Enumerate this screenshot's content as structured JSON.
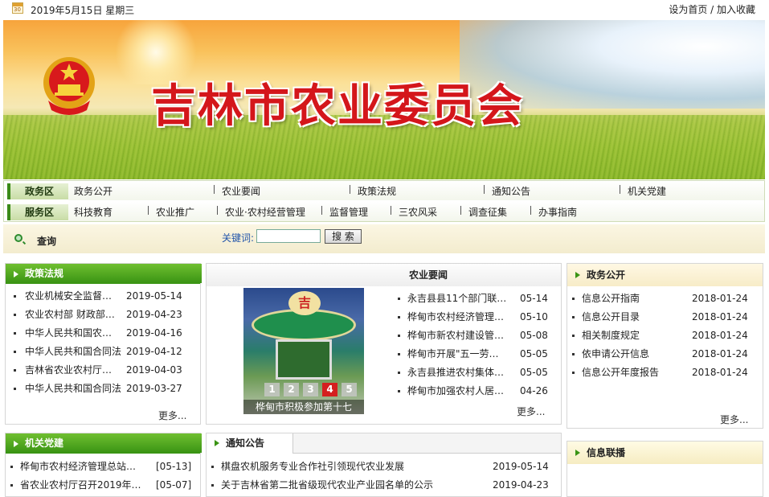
{
  "topbar": {
    "date": "2019年5月15日 星期三",
    "calendar_icon_text": "30",
    "links": "设为首页 / 加入收藏"
  },
  "banner": {
    "title": "吉林市农业委员会"
  },
  "nav": {
    "row1": {
      "label": "政务区",
      "items": [
        "政务公开",
        "农业要闻",
        "政策法规",
        "通知公告",
        "机关党建"
      ]
    },
    "row2": {
      "label": "服务区",
      "items": [
        "科技教育",
        "农业推广",
        "农业·农村经营管理",
        "监督管理",
        "三农风采",
        "调查征集",
        "办事指南"
      ]
    }
  },
  "search": {
    "title": "查询",
    "keyword_label": "关键词:",
    "input_value": "",
    "button": "搜 索"
  },
  "policy": {
    "title": "政策法规",
    "items": [
      {
        "title": "农业机械安全监督…",
        "date": "2019-05-14"
      },
      {
        "title": "农业农村部 财政部…",
        "date": "2019-04-23"
      },
      {
        "title": "中华人民共和国农…",
        "date": "2019-04-16"
      },
      {
        "title": "中华人民共和国合同法",
        "date": "2019-04-12"
      },
      {
        "title": "吉林省农业农村厅…",
        "date": "2019-04-03"
      },
      {
        "title": "中华人民共和国合同法",
        "date": "2019-03-27"
      }
    ],
    "more": "更多..."
  },
  "news": {
    "title": "农业要闻",
    "photo": {
      "badge": "吉",
      "numbers": [
        "1",
        "2",
        "3",
        "4",
        "5"
      ],
      "active_index": 3,
      "caption": "桦甸市积极参加第十七"
    },
    "items": [
      {
        "title": "永吉县县11个部门联…",
        "date": "05-14"
      },
      {
        "title": "桦甸市农村经济管理…",
        "date": "05-10"
      },
      {
        "title": "桦甸市新农村建设管…",
        "date": "05-08"
      },
      {
        "title": "桦甸市开展\"五一劳…",
        "date": "05-05"
      },
      {
        "title": "永吉县推进农村集体…",
        "date": "05-05"
      },
      {
        "title": "桦甸市加强农村人居…",
        "date": "04-26"
      }
    ],
    "more": "更多..."
  },
  "gov": {
    "title": "政务公开",
    "items": [
      {
        "title": "信息公开指南",
        "date": "2018-01-24"
      },
      {
        "title": "信息公开目录",
        "date": "2018-01-24"
      },
      {
        "title": "相关制度规定",
        "date": "2018-01-24"
      },
      {
        "title": "依申请公开信息",
        "date": "2018-01-24"
      },
      {
        "title": "信息公开年度报告",
        "date": "2018-01-24"
      }
    ],
    "more": "更多..."
  },
  "party": {
    "title": "机关党建",
    "items": [
      {
        "title": "桦甸市农村经济管理总站…",
        "date": "[05-13]"
      },
      {
        "title": "省农业农村厅召开2019年…",
        "date": "[05-07]"
      }
    ]
  },
  "notice": {
    "title": "通知公告",
    "items": [
      {
        "title": "棋盘农机服务专业合作社引领现代农业发展",
        "date": "2019-05-14"
      },
      {
        "title": "关于吉林省第二批省级现代农业产业园名单的公示",
        "date": "2019-04-23"
      }
    ]
  },
  "contact": {
    "title": "信息联播"
  }
}
